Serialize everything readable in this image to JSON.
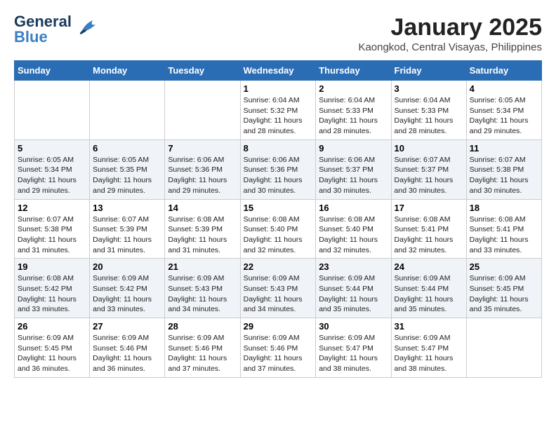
{
  "logo": {
    "line1": "General",
    "line2": "Blue"
  },
  "title": "January 2025",
  "location": "Kaongkod, Central Visayas, Philippines",
  "weekdays": [
    "Sunday",
    "Monday",
    "Tuesday",
    "Wednesday",
    "Thursday",
    "Friday",
    "Saturday"
  ],
  "weeks": [
    [
      {
        "day": "",
        "sunrise": "",
        "sunset": "",
        "daylight": ""
      },
      {
        "day": "",
        "sunrise": "",
        "sunset": "",
        "daylight": ""
      },
      {
        "day": "",
        "sunrise": "",
        "sunset": "",
        "daylight": ""
      },
      {
        "day": "1",
        "sunrise": "Sunrise: 6:04 AM",
        "sunset": "Sunset: 5:32 PM",
        "daylight": "Daylight: 11 hours and 28 minutes."
      },
      {
        "day": "2",
        "sunrise": "Sunrise: 6:04 AM",
        "sunset": "Sunset: 5:33 PM",
        "daylight": "Daylight: 11 hours and 28 minutes."
      },
      {
        "day": "3",
        "sunrise": "Sunrise: 6:04 AM",
        "sunset": "Sunset: 5:33 PM",
        "daylight": "Daylight: 11 hours and 28 minutes."
      },
      {
        "day": "4",
        "sunrise": "Sunrise: 6:05 AM",
        "sunset": "Sunset: 5:34 PM",
        "daylight": "Daylight: 11 hours and 29 minutes."
      }
    ],
    [
      {
        "day": "5",
        "sunrise": "Sunrise: 6:05 AM",
        "sunset": "Sunset: 5:34 PM",
        "daylight": "Daylight: 11 hours and 29 minutes."
      },
      {
        "day": "6",
        "sunrise": "Sunrise: 6:05 AM",
        "sunset": "Sunset: 5:35 PM",
        "daylight": "Daylight: 11 hours and 29 minutes."
      },
      {
        "day": "7",
        "sunrise": "Sunrise: 6:06 AM",
        "sunset": "Sunset: 5:36 PM",
        "daylight": "Daylight: 11 hours and 29 minutes."
      },
      {
        "day": "8",
        "sunrise": "Sunrise: 6:06 AM",
        "sunset": "Sunset: 5:36 PM",
        "daylight": "Daylight: 11 hours and 30 minutes."
      },
      {
        "day": "9",
        "sunrise": "Sunrise: 6:06 AM",
        "sunset": "Sunset: 5:37 PM",
        "daylight": "Daylight: 11 hours and 30 minutes."
      },
      {
        "day": "10",
        "sunrise": "Sunrise: 6:07 AM",
        "sunset": "Sunset: 5:37 PM",
        "daylight": "Daylight: 11 hours and 30 minutes."
      },
      {
        "day": "11",
        "sunrise": "Sunrise: 6:07 AM",
        "sunset": "Sunset: 5:38 PM",
        "daylight": "Daylight: 11 hours and 30 minutes."
      }
    ],
    [
      {
        "day": "12",
        "sunrise": "Sunrise: 6:07 AM",
        "sunset": "Sunset: 5:38 PM",
        "daylight": "Daylight: 11 hours and 31 minutes."
      },
      {
        "day": "13",
        "sunrise": "Sunrise: 6:07 AM",
        "sunset": "Sunset: 5:39 PM",
        "daylight": "Daylight: 11 hours and 31 minutes."
      },
      {
        "day": "14",
        "sunrise": "Sunrise: 6:08 AM",
        "sunset": "Sunset: 5:39 PM",
        "daylight": "Daylight: 11 hours and 31 minutes."
      },
      {
        "day": "15",
        "sunrise": "Sunrise: 6:08 AM",
        "sunset": "Sunset: 5:40 PM",
        "daylight": "Daylight: 11 hours and 32 minutes."
      },
      {
        "day": "16",
        "sunrise": "Sunrise: 6:08 AM",
        "sunset": "Sunset: 5:40 PM",
        "daylight": "Daylight: 11 hours and 32 minutes."
      },
      {
        "day": "17",
        "sunrise": "Sunrise: 6:08 AM",
        "sunset": "Sunset: 5:41 PM",
        "daylight": "Daylight: 11 hours and 32 minutes."
      },
      {
        "day": "18",
        "sunrise": "Sunrise: 6:08 AM",
        "sunset": "Sunset: 5:41 PM",
        "daylight": "Daylight: 11 hours and 33 minutes."
      }
    ],
    [
      {
        "day": "19",
        "sunrise": "Sunrise: 6:08 AM",
        "sunset": "Sunset: 5:42 PM",
        "daylight": "Daylight: 11 hours and 33 minutes."
      },
      {
        "day": "20",
        "sunrise": "Sunrise: 6:09 AM",
        "sunset": "Sunset: 5:42 PM",
        "daylight": "Daylight: 11 hours and 33 minutes."
      },
      {
        "day": "21",
        "sunrise": "Sunrise: 6:09 AM",
        "sunset": "Sunset: 5:43 PM",
        "daylight": "Daylight: 11 hours and 34 minutes."
      },
      {
        "day": "22",
        "sunrise": "Sunrise: 6:09 AM",
        "sunset": "Sunset: 5:43 PM",
        "daylight": "Daylight: 11 hours and 34 minutes."
      },
      {
        "day": "23",
        "sunrise": "Sunrise: 6:09 AM",
        "sunset": "Sunset: 5:44 PM",
        "daylight": "Daylight: 11 hours and 35 minutes."
      },
      {
        "day": "24",
        "sunrise": "Sunrise: 6:09 AM",
        "sunset": "Sunset: 5:44 PM",
        "daylight": "Daylight: 11 hours and 35 minutes."
      },
      {
        "day": "25",
        "sunrise": "Sunrise: 6:09 AM",
        "sunset": "Sunset: 5:45 PM",
        "daylight": "Daylight: 11 hours and 35 minutes."
      }
    ],
    [
      {
        "day": "26",
        "sunrise": "Sunrise: 6:09 AM",
        "sunset": "Sunset: 5:45 PM",
        "daylight": "Daylight: 11 hours and 36 minutes."
      },
      {
        "day": "27",
        "sunrise": "Sunrise: 6:09 AM",
        "sunset": "Sunset: 5:46 PM",
        "daylight": "Daylight: 11 hours and 36 minutes."
      },
      {
        "day": "28",
        "sunrise": "Sunrise: 6:09 AM",
        "sunset": "Sunset: 5:46 PM",
        "daylight": "Daylight: 11 hours and 37 minutes."
      },
      {
        "day": "29",
        "sunrise": "Sunrise: 6:09 AM",
        "sunset": "Sunset: 5:46 PM",
        "daylight": "Daylight: 11 hours and 37 minutes."
      },
      {
        "day": "30",
        "sunrise": "Sunrise: 6:09 AM",
        "sunset": "Sunset: 5:47 PM",
        "daylight": "Daylight: 11 hours and 38 minutes."
      },
      {
        "day": "31",
        "sunrise": "Sunrise: 6:09 AM",
        "sunset": "Sunset: 5:47 PM",
        "daylight": "Daylight: 11 hours and 38 minutes."
      },
      {
        "day": "",
        "sunrise": "",
        "sunset": "",
        "daylight": ""
      }
    ]
  ]
}
